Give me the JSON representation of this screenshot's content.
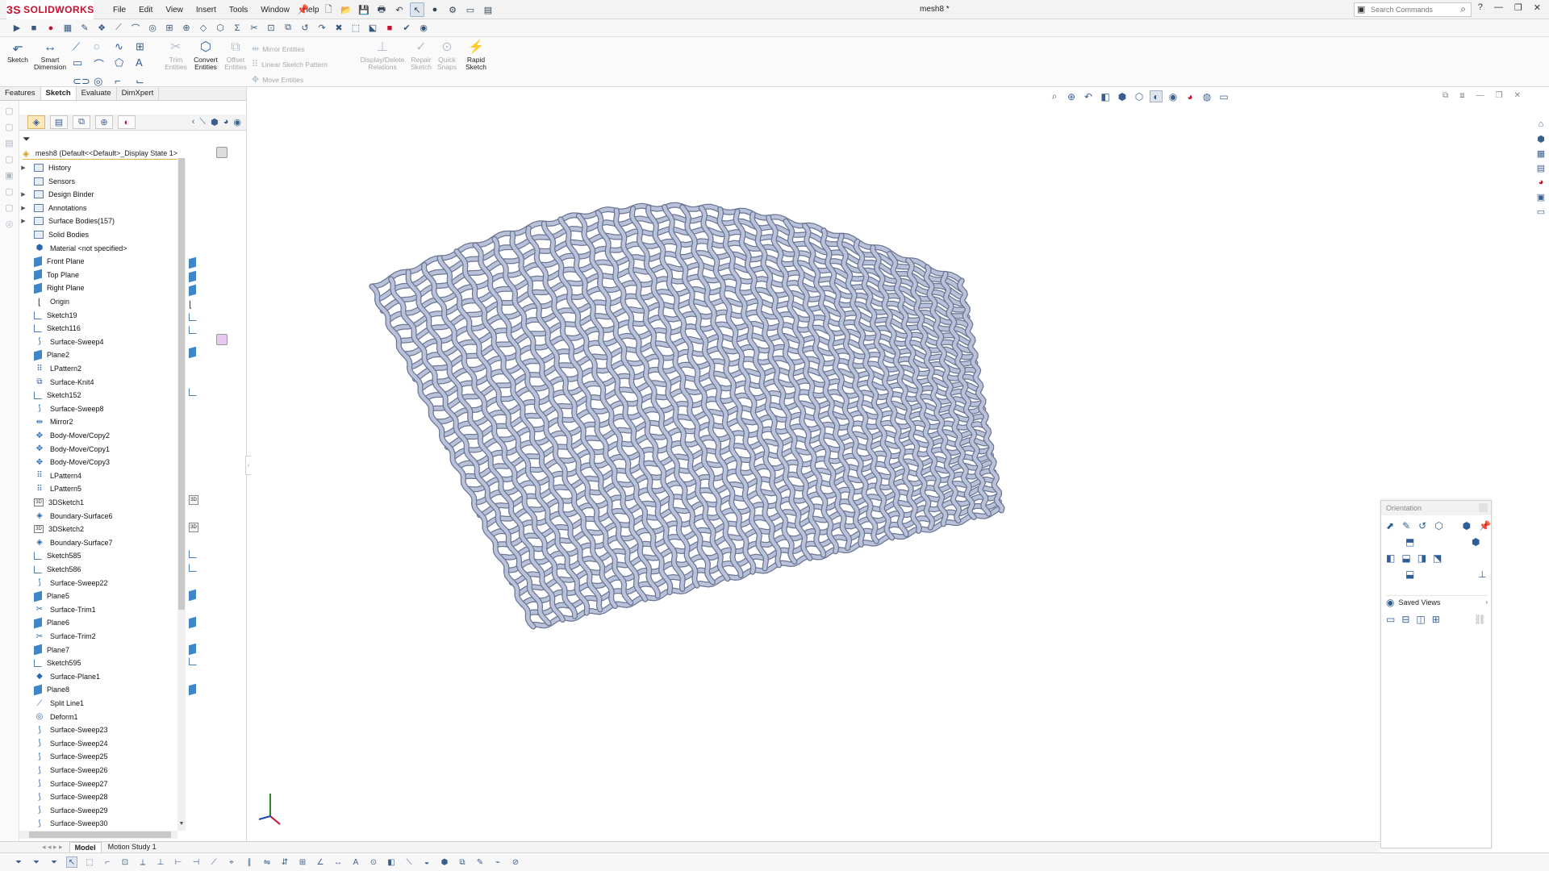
{
  "app": {
    "logo_text": "SOLIDWORKS",
    "logo_mark": "3S",
    "document_title": "mesh8 *"
  },
  "menu": [
    "File",
    "Edit",
    "View",
    "Insert",
    "Tools",
    "Window",
    "Help"
  ],
  "search": {
    "placeholder": "Search Commands"
  },
  "ribbon": {
    "sketch": "Sketch",
    "smart_dimension": "Smart\nDimension",
    "trim_entities": "Trim\nEntities",
    "convert_entities": "Convert\nEntities",
    "offset_entities": "Offset\nEntities",
    "mirror_entities": "Mirror Entities",
    "linear_sketch_pattern": "Linear Sketch Pattern",
    "move_entities": "Move Entities",
    "display_delete_relations": "Display/Delete\nRelations",
    "repair_sketch": "Repair\nSketch",
    "quick_snaps": "Quick\nSnaps",
    "rapid_sketch": "Rapid\nSketch"
  },
  "command_tabs": [
    "Features",
    "Sketch",
    "Evaluate",
    "DimXpert"
  ],
  "active_tab": "Sketch",
  "tree": {
    "root": "mesh8  (Default<<Default>_Display State 1>",
    "items": [
      {
        "label": "History",
        "icon": "folder",
        "expand": true
      },
      {
        "label": "Sensors",
        "icon": "folder",
        "expand": false
      },
      {
        "label": "Design Binder",
        "icon": "folder",
        "expand": true
      },
      {
        "label": "Annotations",
        "icon": "folder",
        "expand": true
      },
      {
        "label": "Surface Bodies(157)",
        "icon": "folder",
        "expand": true
      },
      {
        "label": "Solid Bodies",
        "icon": "folder",
        "expand": false
      },
      {
        "label": "Material <not specified>",
        "icon": "material",
        "expand": false
      },
      {
        "label": "Front Plane",
        "icon": "plane",
        "expand": false
      },
      {
        "label": "Top Plane",
        "icon": "plane",
        "expand": false
      },
      {
        "label": "Right Plane",
        "icon": "plane",
        "expand": false
      },
      {
        "label": "Origin",
        "icon": "origin",
        "expand": false
      },
      {
        "label": "Sketch19",
        "icon": "sketch",
        "expand": false
      },
      {
        "label": "Sketch116",
        "icon": "sketch",
        "expand": false
      },
      {
        "label": "Surface-Sweep4",
        "icon": "sweep",
        "expand": false
      },
      {
        "label": "Plane2",
        "icon": "plane",
        "expand": false
      },
      {
        "label": "LPattern2",
        "icon": "pattern",
        "expand": false
      },
      {
        "label": "Surface-Knit4",
        "icon": "knit",
        "expand": false
      },
      {
        "label": "Sketch152",
        "icon": "sketch",
        "expand": false
      },
      {
        "label": "Surface-Sweep8",
        "icon": "sweep",
        "expand": false
      },
      {
        "label": "Mirror2",
        "icon": "mirror",
        "expand": false
      },
      {
        "label": "Body-Move/Copy2",
        "icon": "move",
        "expand": false
      },
      {
        "label": "Body-Move/Copy1",
        "icon": "move",
        "expand": false
      },
      {
        "label": "Body-Move/Copy3",
        "icon": "move",
        "expand": false
      },
      {
        "label": "LPattern4",
        "icon": "pattern",
        "expand": false
      },
      {
        "label": "LPattern5",
        "icon": "pattern",
        "expand": false
      },
      {
        "label": "3DSketch1",
        "icon": "sketch3d",
        "expand": false
      },
      {
        "label": "Boundary-Surface6",
        "icon": "boundary",
        "expand": false
      },
      {
        "label": "3DSketch2",
        "icon": "sketch3d",
        "expand": false
      },
      {
        "label": "Boundary-Surface7",
        "icon": "boundary",
        "expand": false
      },
      {
        "label": "Sketch585",
        "icon": "sketch",
        "expand": false
      },
      {
        "label": "Sketch586",
        "icon": "sketch",
        "expand": false
      },
      {
        "label": "Surface-Sweep22",
        "icon": "sweep",
        "expand": false
      },
      {
        "label": "Plane5",
        "icon": "plane",
        "expand": false
      },
      {
        "label": "Surface-Trim1",
        "icon": "trim",
        "expand": false
      },
      {
        "label": "Plane6",
        "icon": "plane",
        "expand": false
      },
      {
        "label": "Surface-Trim2",
        "icon": "trim",
        "expand": false
      },
      {
        "label": "Plane7",
        "icon": "plane",
        "expand": false
      },
      {
        "label": "Sketch595",
        "icon": "sketch",
        "expand": false
      },
      {
        "label": "Surface-Plane1",
        "icon": "surfplane",
        "expand": false
      },
      {
        "label": "Plane8",
        "icon": "plane",
        "expand": false
      },
      {
        "label": "Split Line1",
        "icon": "split",
        "expand": false
      },
      {
        "label": "Deform1",
        "icon": "deform",
        "expand": false
      },
      {
        "label": "Surface-Sweep23",
        "icon": "sweep",
        "expand": false
      },
      {
        "label": "Surface-Sweep24",
        "icon": "sweep",
        "expand": false
      },
      {
        "label": "Surface-Sweep25",
        "icon": "sweep",
        "expand": false
      },
      {
        "label": "Surface-Sweep26",
        "icon": "sweep",
        "expand": false
      },
      {
        "label": "Surface-Sweep27",
        "icon": "sweep",
        "expand": false
      },
      {
        "label": "Surface-Sweep28",
        "icon": "sweep",
        "expand": false
      },
      {
        "label": "Surface-Sweep29",
        "icon": "sweep",
        "expand": false
      },
      {
        "label": "Surface-Sweep30",
        "icon": "sweep",
        "expand": false
      }
    ]
  },
  "bottom_tabs": [
    "Model",
    "Motion Study 1"
  ],
  "active_bottom_tab": "Model",
  "orientation_panel": {
    "title": "Orientation",
    "saved_views": "Saved Views"
  },
  "colors": {
    "accent": "#c8102e",
    "toolbar_blue": "#2d5e97",
    "mesh_strand": "#b9c2d9",
    "mesh_stroke": "#6b7594"
  }
}
